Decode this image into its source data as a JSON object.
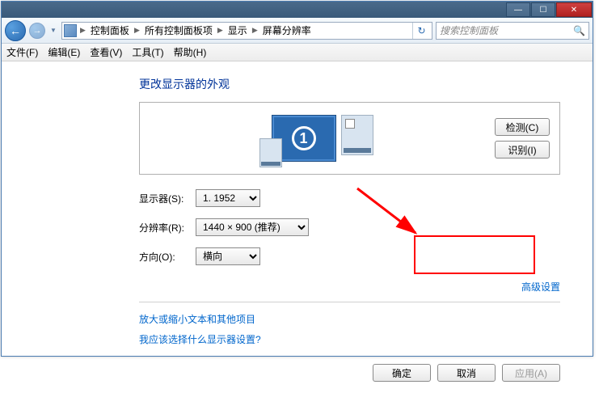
{
  "window": {
    "minimize": "—",
    "maximize": "☐",
    "close": "✕"
  },
  "nav": {
    "back": "←",
    "forward": "→"
  },
  "breadcrumb": {
    "item1": "控制面板",
    "item2": "所有控制面板项",
    "item3": "显示",
    "item4": "屏幕分辨率",
    "sep": "▶"
  },
  "search": {
    "placeholder": "搜索控制面板",
    "icon": "🔍"
  },
  "menu": {
    "file": "文件(F)",
    "edit": "编辑(E)",
    "view": "查看(V)",
    "tools": "工具(T)",
    "help": "帮助(H)"
  },
  "page": {
    "title": "更改显示器的外观"
  },
  "monitor": {
    "number": "1",
    "detect": "检测(C)",
    "identify": "识别(I)"
  },
  "form": {
    "display_label": "显示器(S):",
    "display_value": "1. 1952",
    "resolution_label": "分辨率(R):",
    "resolution_value": "1440 × 900 (推荐)",
    "orientation_label": "方向(O):",
    "orientation_value": "横向"
  },
  "links": {
    "advanced": "高级设置",
    "textsize": "放大或缩小文本和其他项目",
    "which": "我应该选择什么显示器设置?"
  },
  "buttons": {
    "ok": "确定",
    "cancel": "取消",
    "apply": "应用(A)"
  }
}
